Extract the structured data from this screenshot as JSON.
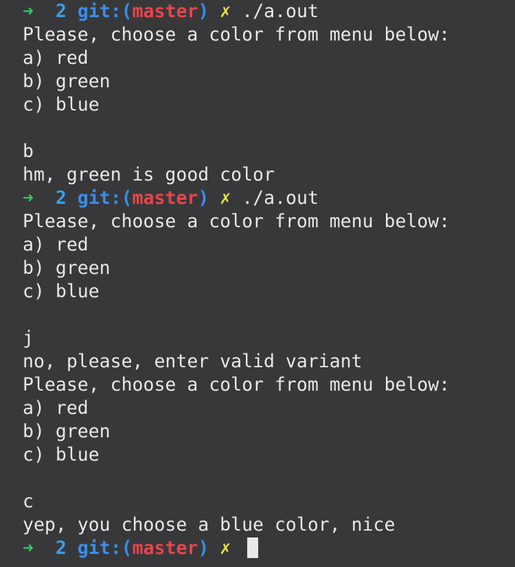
{
  "prompt": {
    "arrow": "➜",
    "dir": "2",
    "git_label": "git:",
    "open_paren": "(",
    "branch": "master",
    "close_paren": ")",
    "dirty_mark": "✗"
  },
  "colors": {
    "background": "#38383a",
    "text": "#e8e8e8",
    "arrow": "#32c85a",
    "dir": "#3aa0e8",
    "git": "#3a8ee8",
    "branch": "#e8454a",
    "dirty": "#e8e04a"
  },
  "lines": [
    {
      "type": "prompt",
      "command": "./a.out"
    },
    {
      "type": "out",
      "text": "Please, choose a color from menu below:"
    },
    {
      "type": "out",
      "text": "a) red"
    },
    {
      "type": "out",
      "text": "b) green"
    },
    {
      "type": "out",
      "text": "c) blue"
    },
    {
      "type": "out",
      "text": ""
    },
    {
      "type": "out",
      "text": "b"
    },
    {
      "type": "out",
      "text": "hm, green is good color"
    },
    {
      "type": "prompt",
      "command": "./a.out"
    },
    {
      "type": "out",
      "text": "Please, choose a color from menu below:"
    },
    {
      "type": "out",
      "text": "a) red"
    },
    {
      "type": "out",
      "text": "b) green"
    },
    {
      "type": "out",
      "text": "c) blue"
    },
    {
      "type": "out",
      "text": ""
    },
    {
      "type": "out",
      "text": "j"
    },
    {
      "type": "out",
      "text": "no, please, enter valid variant"
    },
    {
      "type": "out",
      "text": "Please, choose a color from menu below:"
    },
    {
      "type": "out",
      "text": "a) red"
    },
    {
      "type": "out",
      "text": "b) green"
    },
    {
      "type": "out",
      "text": "c) blue"
    },
    {
      "type": "out",
      "text": ""
    },
    {
      "type": "out",
      "text": "c"
    },
    {
      "type": "out",
      "text": "yep, you choose a blue color, nice"
    },
    {
      "type": "prompt",
      "command": "",
      "cursor": true
    }
  ]
}
